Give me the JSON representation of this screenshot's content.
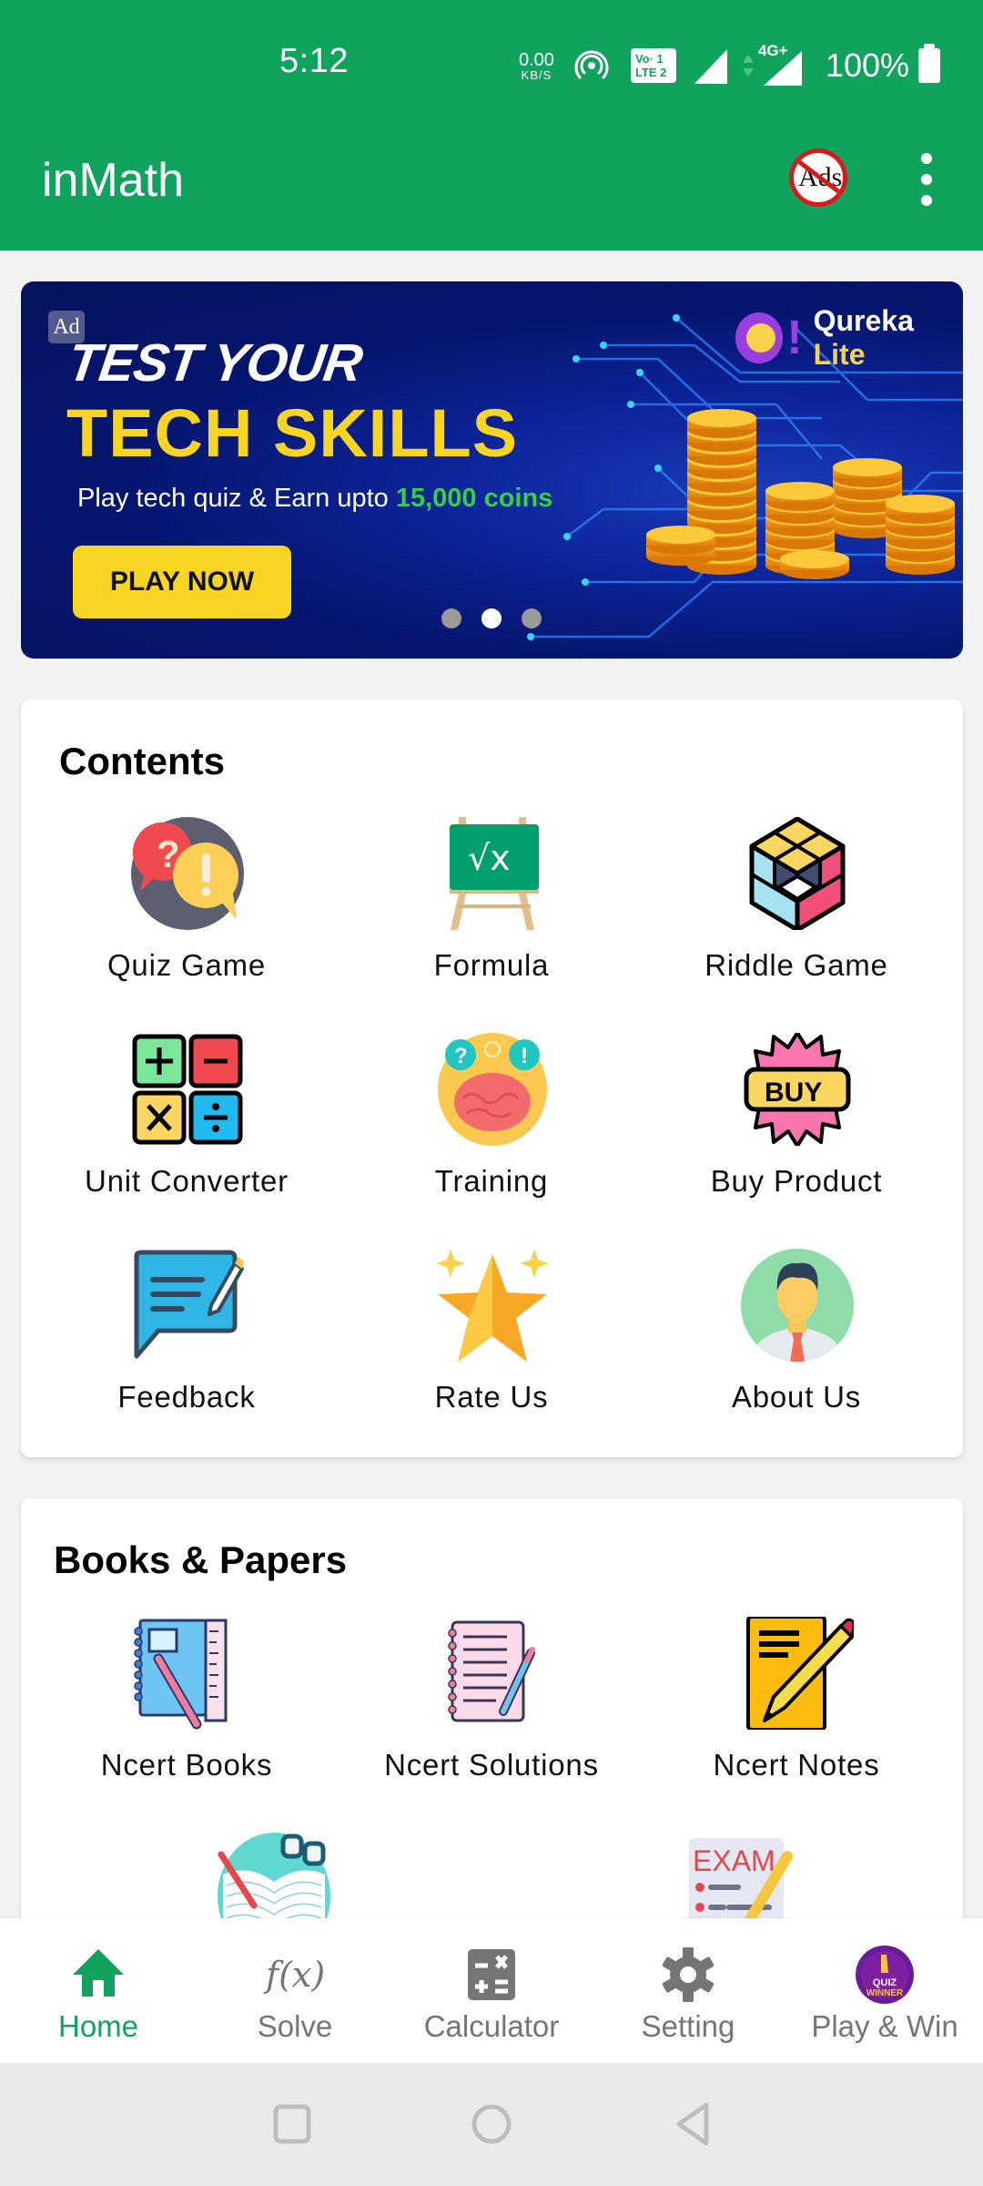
{
  "status_bar": {
    "time": "5:12",
    "net_speed_value": "0.00",
    "net_speed_unit": "KB/S",
    "volte_top": "Vo· 1",
    "volte_bottom": "LTE 2",
    "network_type": "4G+",
    "battery": "100%"
  },
  "app_bar": {
    "title": "inMath",
    "no_ads_label": "Ads",
    "menu_icon": "more-vert-icon",
    "color": "#0fa35d"
  },
  "ad": {
    "badge": "Ad",
    "line1": "TEST YOUR",
    "line2": "TECH SKILLS",
    "line3_prefix": "Play tech quiz & Earn upto ",
    "line3_highlight": "15,000 coins",
    "cta": "PLAY NOW",
    "brand_main": "Qureka ",
    "brand_accent": "Lite",
    "carousel": {
      "count": 3,
      "active_index": 1
    }
  },
  "contents": {
    "title": "Contents",
    "items": [
      {
        "label": "Quiz Game",
        "icon": "quiz-bubbles-icon"
      },
      {
        "label": "Formula",
        "icon": "formula-board-icon"
      },
      {
        "label": "Riddle Game",
        "icon": "cube-puzzle-icon"
      },
      {
        "label": "Unit Converter",
        "icon": "math-operators-icon"
      },
      {
        "label": "Training",
        "icon": "brain-icon"
      },
      {
        "label": "Buy Product",
        "icon": "buy-badge-icon"
      },
      {
        "label": "Feedback",
        "icon": "feedback-chat-icon"
      },
      {
        "label": "Rate Us",
        "icon": "star-icon"
      },
      {
        "label": "About Us",
        "icon": "person-avatar-icon"
      }
    ]
  },
  "books": {
    "title": "Books & Papers",
    "items": [
      {
        "label": "Ncert Books",
        "icon": "notebook-icon"
      },
      {
        "label": "Ncert Solutions",
        "icon": "notepad-pen-icon"
      },
      {
        "label": "Ncert Notes",
        "icon": "notes-pencil-icon"
      },
      {
        "label": "",
        "icon": "open-book-glasses-icon"
      },
      {
        "label": "",
        "icon": "exam-paper-icon"
      }
    ]
  },
  "bottom_nav": {
    "items": [
      {
        "label": "Home",
        "icon": "home-icon",
        "active": true
      },
      {
        "label": "Solve",
        "icon": "function-icon",
        "active": false
      },
      {
        "label": "Calculator",
        "icon": "calculator-icon",
        "active": false
      },
      {
        "label": "Setting",
        "icon": "gear-icon",
        "active": false
      },
      {
        "label": "Play & Win",
        "icon": "quiz-winner-icon",
        "active": false
      }
    ],
    "solve_glyph": "f(x)",
    "quiz_winner_text_1": "QUIZ",
    "quiz_winner_text_2": "WINNER"
  },
  "colors": {
    "primary": "#0fa35d",
    "inactive": "#757575",
    "ad_yellow": "#f9d523",
    "ad_green": "#35d23a"
  }
}
